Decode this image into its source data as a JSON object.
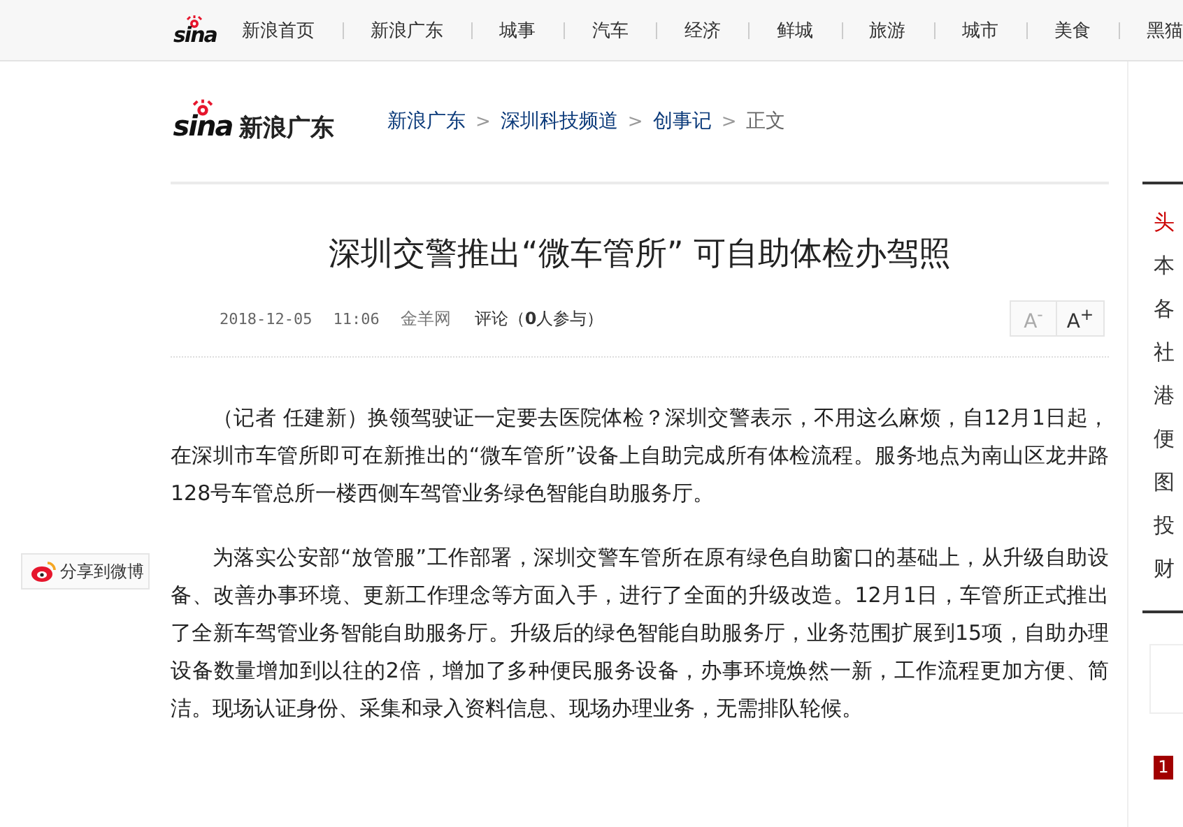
{
  "top_nav": {
    "logo": "sina",
    "items": [
      "新浪首页",
      "新浪广东",
      "城事",
      "汽车",
      "经济",
      "鲜城",
      "旅游",
      "城市",
      "美食",
      "黑猫"
    ]
  },
  "header": {
    "logo": "sina",
    "channel": "新浪广东",
    "breadcrumb": [
      {
        "label": "新浪广东",
        "kind": "link"
      },
      {
        "label": "深圳科技频道",
        "kind": "link"
      },
      {
        "label": "创事记",
        "kind": "link"
      },
      {
        "label": "正文",
        "kind": "current"
      }
    ],
    "separator": ">"
  },
  "article": {
    "title": "深圳交警推出“微车管所” 可自助体检办驾照",
    "date": "2018-12-05",
    "time": "11:06",
    "source": "金羊网",
    "comments": "评论（**0**人参与）",
    "font_buttons": [
      {
        "label": "A",
        "sign": "-"
      },
      {
        "label": "A",
        "sign": "+"
      }
    ],
    "paragraphs": [
      "（记者 任建新）换领驾驶证一定要去医院体检？深圳交警表示，不用这么麻烦，自12月1日起，在深圳市车管所即可在新推出的“微车管所”设备上自助完成所有体检流程。服务地点为南山区龙井路128号车管总所一楼西侧车驾管业务绿色智能自助服务厅。",
      "为落实公安部“放管服”工作部署，深圳交警车管所在原有绿色自助窗口的基础上，从升级自助设备、改善办事环境、更新工作理念等方面入手，进行了全面的升级改造。12月1日，车管所正式推出了全新车驾管业务智能自助服务厅。升级后的绿色智能自助服务厅，业务范围扩展到15项，自助办理设备数量增加到以往的2倍，增加了多种便民服务设备，办事环境焕然一新，工作流程更加方便、简洁。现场认证身份、采集和录入资料信息、现场办理业务，无需排队轮候。"
    ]
  },
  "share": {
    "label": "分享到微博"
  },
  "sidebar": {
    "items": [
      {
        "label": "头",
        "selected": true
      },
      {
        "label": "本",
        "selected": false
      },
      {
        "label": "各",
        "selected": false
      },
      {
        "label": "社",
        "selected": false
      },
      {
        "label": "港",
        "selected": false
      },
      {
        "label": "便",
        "selected": false
      },
      {
        "label": "图",
        "selected": false
      },
      {
        "label": "投",
        "selected": false
      },
      {
        "label": "财",
        "selected": false
      }
    ],
    "rank": "1"
  }
}
